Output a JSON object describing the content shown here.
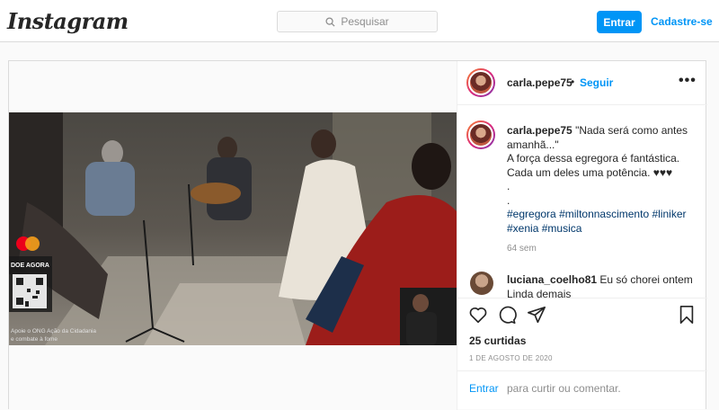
{
  "header": {
    "logo_text": "Instagram",
    "search_placeholder": "Pesquisar",
    "login_label": "Entrar",
    "signup_label": "Cadastre-se"
  },
  "post": {
    "username": "carla.pepe75",
    "separator": "•",
    "follow_label": "Seguir",
    "more_label": "•••",
    "caption": {
      "username": "carla.pepe75",
      "lines": [
        "\"Nada será como antes",
        "amanhã...\"",
        "A força dessa egregora é fantástica.",
        "Cada um deles uma potência. ♥♥♥",
        ".",
        "."
      ],
      "hashtags_line1": [
        "#egregora",
        "#miltonnascimento",
        "#liniker"
      ],
      "hashtags_line2": [
        "#xenia",
        "#musica"
      ]
    },
    "age": "64 sem",
    "comment": {
      "username": "luciana_coelho81",
      "text": "Eu só chorei ontem",
      "text_line2": "Linda demais"
    },
    "likes": "25 curtidas",
    "date": "1 DE AGOSTO DE 2020",
    "add_comment": {
      "enter_label": "Entrar",
      "text": "para curtir ou comentar."
    },
    "video_overlay": {
      "donate_label": "DOE AGORA",
      "bottom_line1": "Apoie o ONG Ação da Cidadania",
      "bottom_line2": "e combate à fome"
    }
  },
  "colors": {
    "accent": "#0095f6",
    "border": "#dbdbdb",
    "muted": "#8e8e8e",
    "hashtag": "#00376b"
  }
}
